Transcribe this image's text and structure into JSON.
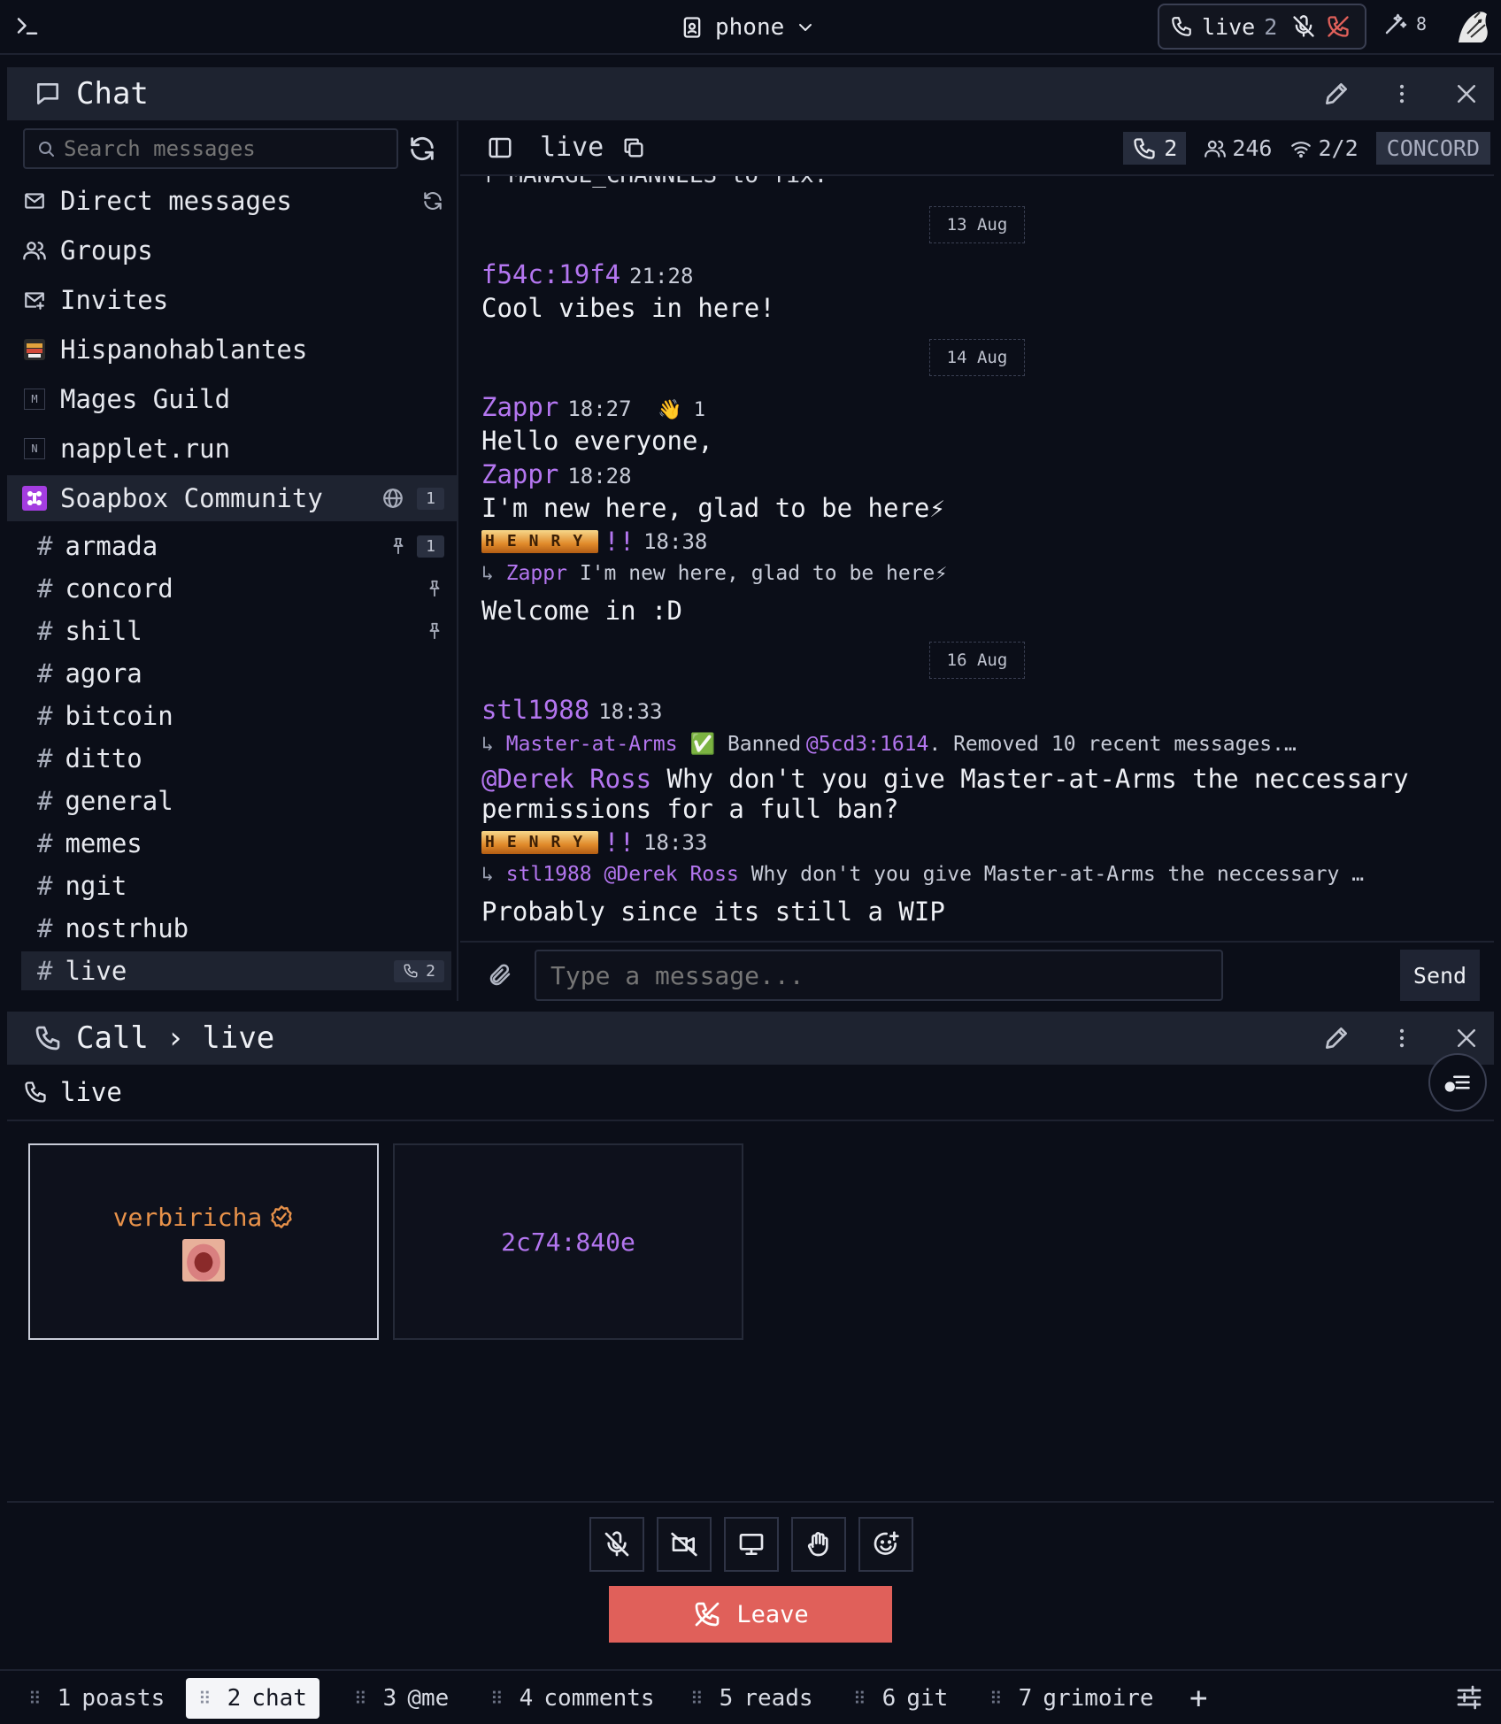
{
  "topbar": {
    "device": "phone",
    "live_label": "live",
    "live_count": "2",
    "wand_count": "8"
  },
  "chat_panel": {
    "title": "Chat"
  },
  "sidebar": {
    "search_placeholder": "Search messages",
    "nav": [
      {
        "label": "Direct messages"
      },
      {
        "label": "Groups"
      },
      {
        "label": "Invites"
      },
      {
        "label": "Hispanohablantes"
      },
      {
        "label": "Mages Guild",
        "letter": "M"
      },
      {
        "label": "napplet.run",
        "letter": "N"
      },
      {
        "label": "Soapbox Community",
        "badge": "1"
      }
    ],
    "channels": [
      {
        "name": "armada",
        "badge": "1",
        "pinned": true
      },
      {
        "name": "concord",
        "pinned": true
      },
      {
        "name": "shill",
        "pinned": true
      },
      {
        "name": "agora"
      },
      {
        "name": "bitcoin"
      },
      {
        "name": "ditto"
      },
      {
        "name": "general"
      },
      {
        "name": "memes"
      },
      {
        "name": "ngit"
      },
      {
        "name": "nostrhub"
      },
      {
        "name": "live",
        "call_count": "2"
      }
    ]
  },
  "channel": {
    "name": "live",
    "call_participants": "2",
    "members": "246",
    "relays": "2/2",
    "protocol": "CONCORD"
  },
  "messages": {
    "cut_text": "↑ MANAGE_CHANNELS to fix.",
    "date1": "13 Aug",
    "m1_author": "f54c:19f4",
    "m1_time": "21:28",
    "m1_text": "Cool vibes in here!",
    "date2": "14 Aug",
    "m2_author": "Zappr",
    "m2_time": "18:27",
    "m2_reaction": "👋",
    "m2_reaction_count": "1",
    "m2_text": "Hello everyone,",
    "m3_author": "Zappr",
    "m3_time": "18:28",
    "m3_text": "I'm new here, glad to be here⚡",
    "m4_author_letters": "HENRY",
    "m4_author_suffix": "!!",
    "m4_time": "18:38",
    "m4_reply_author": "Zappr",
    "m4_reply_text": "I'm new here, glad to be here⚡",
    "m4_text": "Welcome in :D",
    "date3": "16 Aug",
    "m5_author": "stl1988",
    "m5_time": "18:33",
    "m5_reply_author": "Master-at-Arms",
    "m5_reply_check": "✅",
    "m5_reply_pre": "Banned",
    "m5_reply_mention": "@5cd3:1614",
    "m5_reply_post": ". Removed 10 recent messages.…",
    "m5_mention": "@Derek Ross",
    "m5_text_1": "Why don't you give Master-at-Arms the neccessary",
    "m5_text_2": "permissions for a full ban?",
    "m6_author_letters": "HENRY",
    "m6_author_suffix": "!!",
    "m6_time": "18:33",
    "m6_reply_author": "stl1988",
    "m6_reply_mention": "@Derek Ross",
    "m6_reply_text": "Why don't you give Master-at-Arms the neccessary …",
    "m6_text": "Probably since its still a WIP"
  },
  "composer": {
    "placeholder": "Type a message...",
    "send_label": "Send"
  },
  "call_panel": {
    "title": "Call",
    "sep": "›",
    "channel": "live",
    "sub_label": "live",
    "participants": [
      {
        "name": "verbiricha"
      },
      {
        "name": "2c74:840e"
      }
    ],
    "leave_label": "Leave"
  },
  "tabs": [
    {
      "num": "1",
      "label": "poasts"
    },
    {
      "num": "2",
      "label": "chat"
    },
    {
      "num": "3",
      "label": "@me"
    },
    {
      "num": "4",
      "label": "comments"
    },
    {
      "num": "5",
      "label": "reads"
    },
    {
      "num": "6",
      "label": "git"
    },
    {
      "num": "7",
      "label": "grimoire"
    }
  ],
  "tabs_add": "+"
}
